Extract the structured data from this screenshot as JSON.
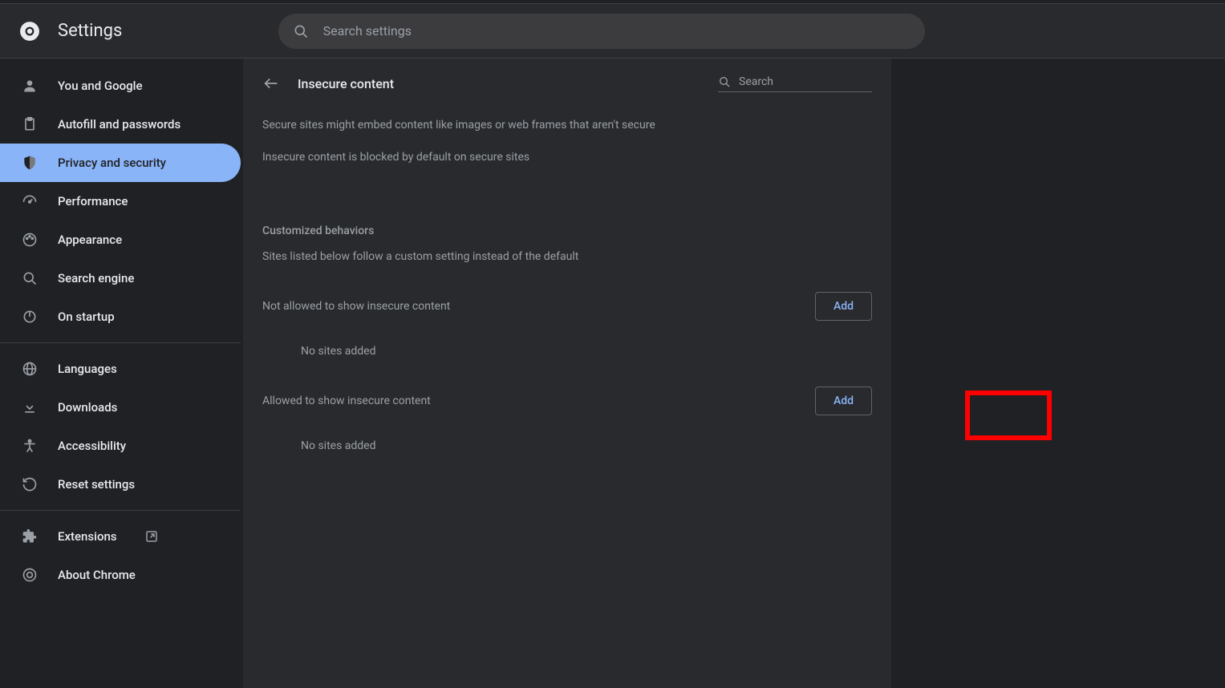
{
  "header": {
    "title": "Settings",
    "search_placeholder": "Search settings"
  },
  "sidebar": {
    "items": [
      {
        "label": "You and Google"
      },
      {
        "label": "Autofill and passwords"
      },
      {
        "label": "Privacy and security"
      },
      {
        "label": "Performance"
      },
      {
        "label": "Appearance"
      },
      {
        "label": "Search engine"
      },
      {
        "label": "On startup"
      }
    ],
    "items2": [
      {
        "label": "Languages"
      },
      {
        "label": "Downloads"
      },
      {
        "label": "Accessibility"
      },
      {
        "label": "Reset settings"
      }
    ],
    "items3": [
      {
        "label": "Extensions"
      },
      {
        "label": "About Chrome"
      }
    ]
  },
  "content": {
    "page_title": "Insecure content",
    "mini_search_placeholder": "Search",
    "desc1": "Secure sites might embed content like images or web frames that aren't secure",
    "desc2": "Insecure content is blocked by default on secure sites",
    "section_header": "Customized behaviors",
    "section_sub": "Sites listed below follow a custom setting instead of the default",
    "not_allowed_label": "Not allowed to show insecure content",
    "allowed_label": "Allowed to show insecure content",
    "add_label": "Add",
    "empty_text": "No sites added"
  }
}
